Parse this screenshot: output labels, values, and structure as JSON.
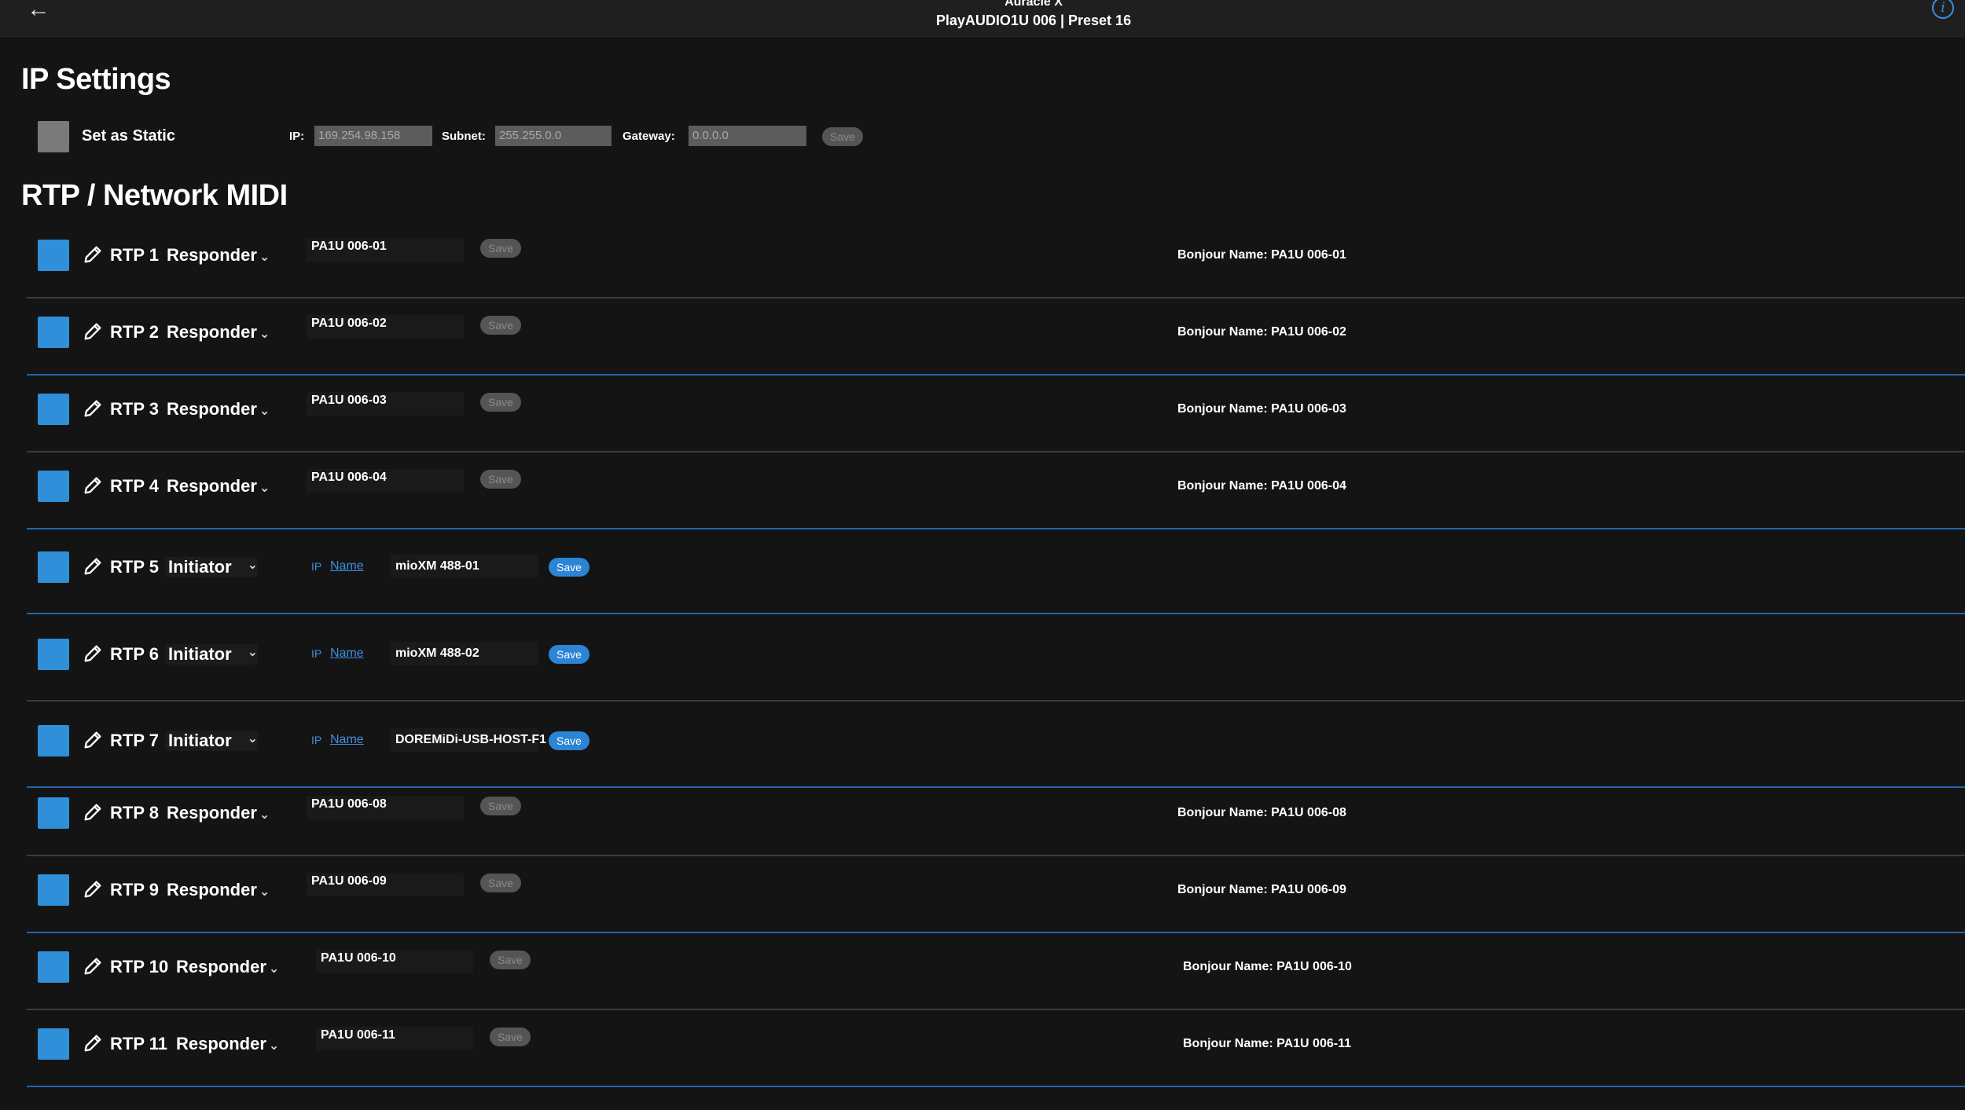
{
  "header": {
    "back_icon": "arrow-left-icon",
    "app_title": "Auracle X",
    "subtitle": "PlayAUDIO1U 006 | Preset 16",
    "info_icon": "info-icon"
  },
  "ip_settings": {
    "heading": "IP Settings",
    "static_label": "Set as Static",
    "ip_label": "IP:",
    "ip_value": "169.254.98.158",
    "subnet_label": "Subnet:",
    "subnet_value": "255.255.0.0",
    "gateway_label": "Gateway:",
    "gateway_value": "0.0.0.0",
    "save_label": "Save"
  },
  "rtp": {
    "heading": "RTP / Network MIDI",
    "save_label": "Save",
    "bonjour_prefix": "Bonjour Name:",
    "rows": [
      {
        "label": "RTP 1",
        "mode": "Responder",
        "name": "PA1U 006-01",
        "bonjour": "Bonjour Name: PA1U 006-01"
      },
      {
        "label": "RTP 2",
        "mode": "Responder",
        "name": "PA1U 006-02",
        "bonjour": "Bonjour Name: PA1U 006-02"
      },
      {
        "label": "RTP 3",
        "mode": "Responder",
        "name": "PA1U 006-03",
        "bonjour": "Bonjour Name: PA1U 006-03"
      },
      {
        "label": "RTP 4",
        "mode": "Responder",
        "name": "PA1U 006-04",
        "bonjour": "Bonjour Name: PA1U 006-04"
      },
      {
        "label": "RTP 5",
        "mode": "Initiator",
        "ip_toggle": "IP",
        "name_toggle": "Name",
        "target": "mioXM 488-01"
      },
      {
        "label": "RTP 6",
        "mode": "Initiator",
        "ip_toggle": "IP",
        "name_toggle": "Name",
        "target": "mioXM 488-02"
      },
      {
        "label": "RTP 7",
        "mode": "Initiator",
        "ip_toggle": "IP",
        "name_toggle": "Name",
        "target": "DOREMiDi-USB-HOST-F1"
      },
      {
        "label": "RTP 8",
        "mode": "Responder",
        "name": "PA1U 006-08",
        "bonjour": "Bonjour Name: PA1U 006-08"
      },
      {
        "label": "RTP 9",
        "mode": "Responder",
        "name": "PA1U 006-09",
        "bonjour": "Bonjour Name: PA1U 006-09"
      },
      {
        "label": "RTP 10",
        "mode": "Responder",
        "name": "PA1U 006-10",
        "bonjour": "Bonjour Name: PA1U 006-10"
      },
      {
        "label": "RTP 11",
        "mode": "Responder",
        "name": "PA1U 006-11",
        "bonjour": "Bonjour Name: PA1U 006-11"
      }
    ]
  },
  "colors": {
    "background": "#141414",
    "accent_blue": "#2f8fd8",
    "disabled_grey": "#555555"
  }
}
